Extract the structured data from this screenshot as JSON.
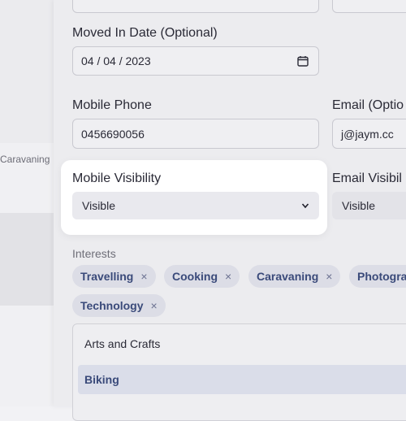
{
  "form": {
    "moved_in_label": "Moved In Date (Optional)",
    "moved_in_value": "04 / 04 / 2023",
    "mobile_phone_label": "Mobile Phone",
    "mobile_phone_value": "0456690056",
    "email_label": "Email (Optio",
    "email_value": "j@jaym.cc",
    "mobile_visibility_label": "Mobile Visibility",
    "mobile_visibility_value": "Visible",
    "email_visibility_label": "Email Visibil",
    "email_visibility_value": "Visible",
    "interests_label": "Interests"
  },
  "background": {
    "sidebar_text": "Caravaning"
  },
  "interests": {
    "chips": [
      {
        "label": "Travelling",
        "remove": "×"
      },
      {
        "label": "Cooking",
        "remove": "×"
      },
      {
        "label": "Caravaning",
        "remove": "×"
      },
      {
        "label": "Photogra",
        "remove": ""
      },
      {
        "label": "Technology",
        "remove": "×"
      }
    ],
    "options": [
      "Arts and Crafts",
      "Biking"
    ]
  },
  "colors": {
    "highlight_bg": "#ffffff",
    "chip_bg": "#dcdde6",
    "chip_text": "#3a4a7a"
  }
}
